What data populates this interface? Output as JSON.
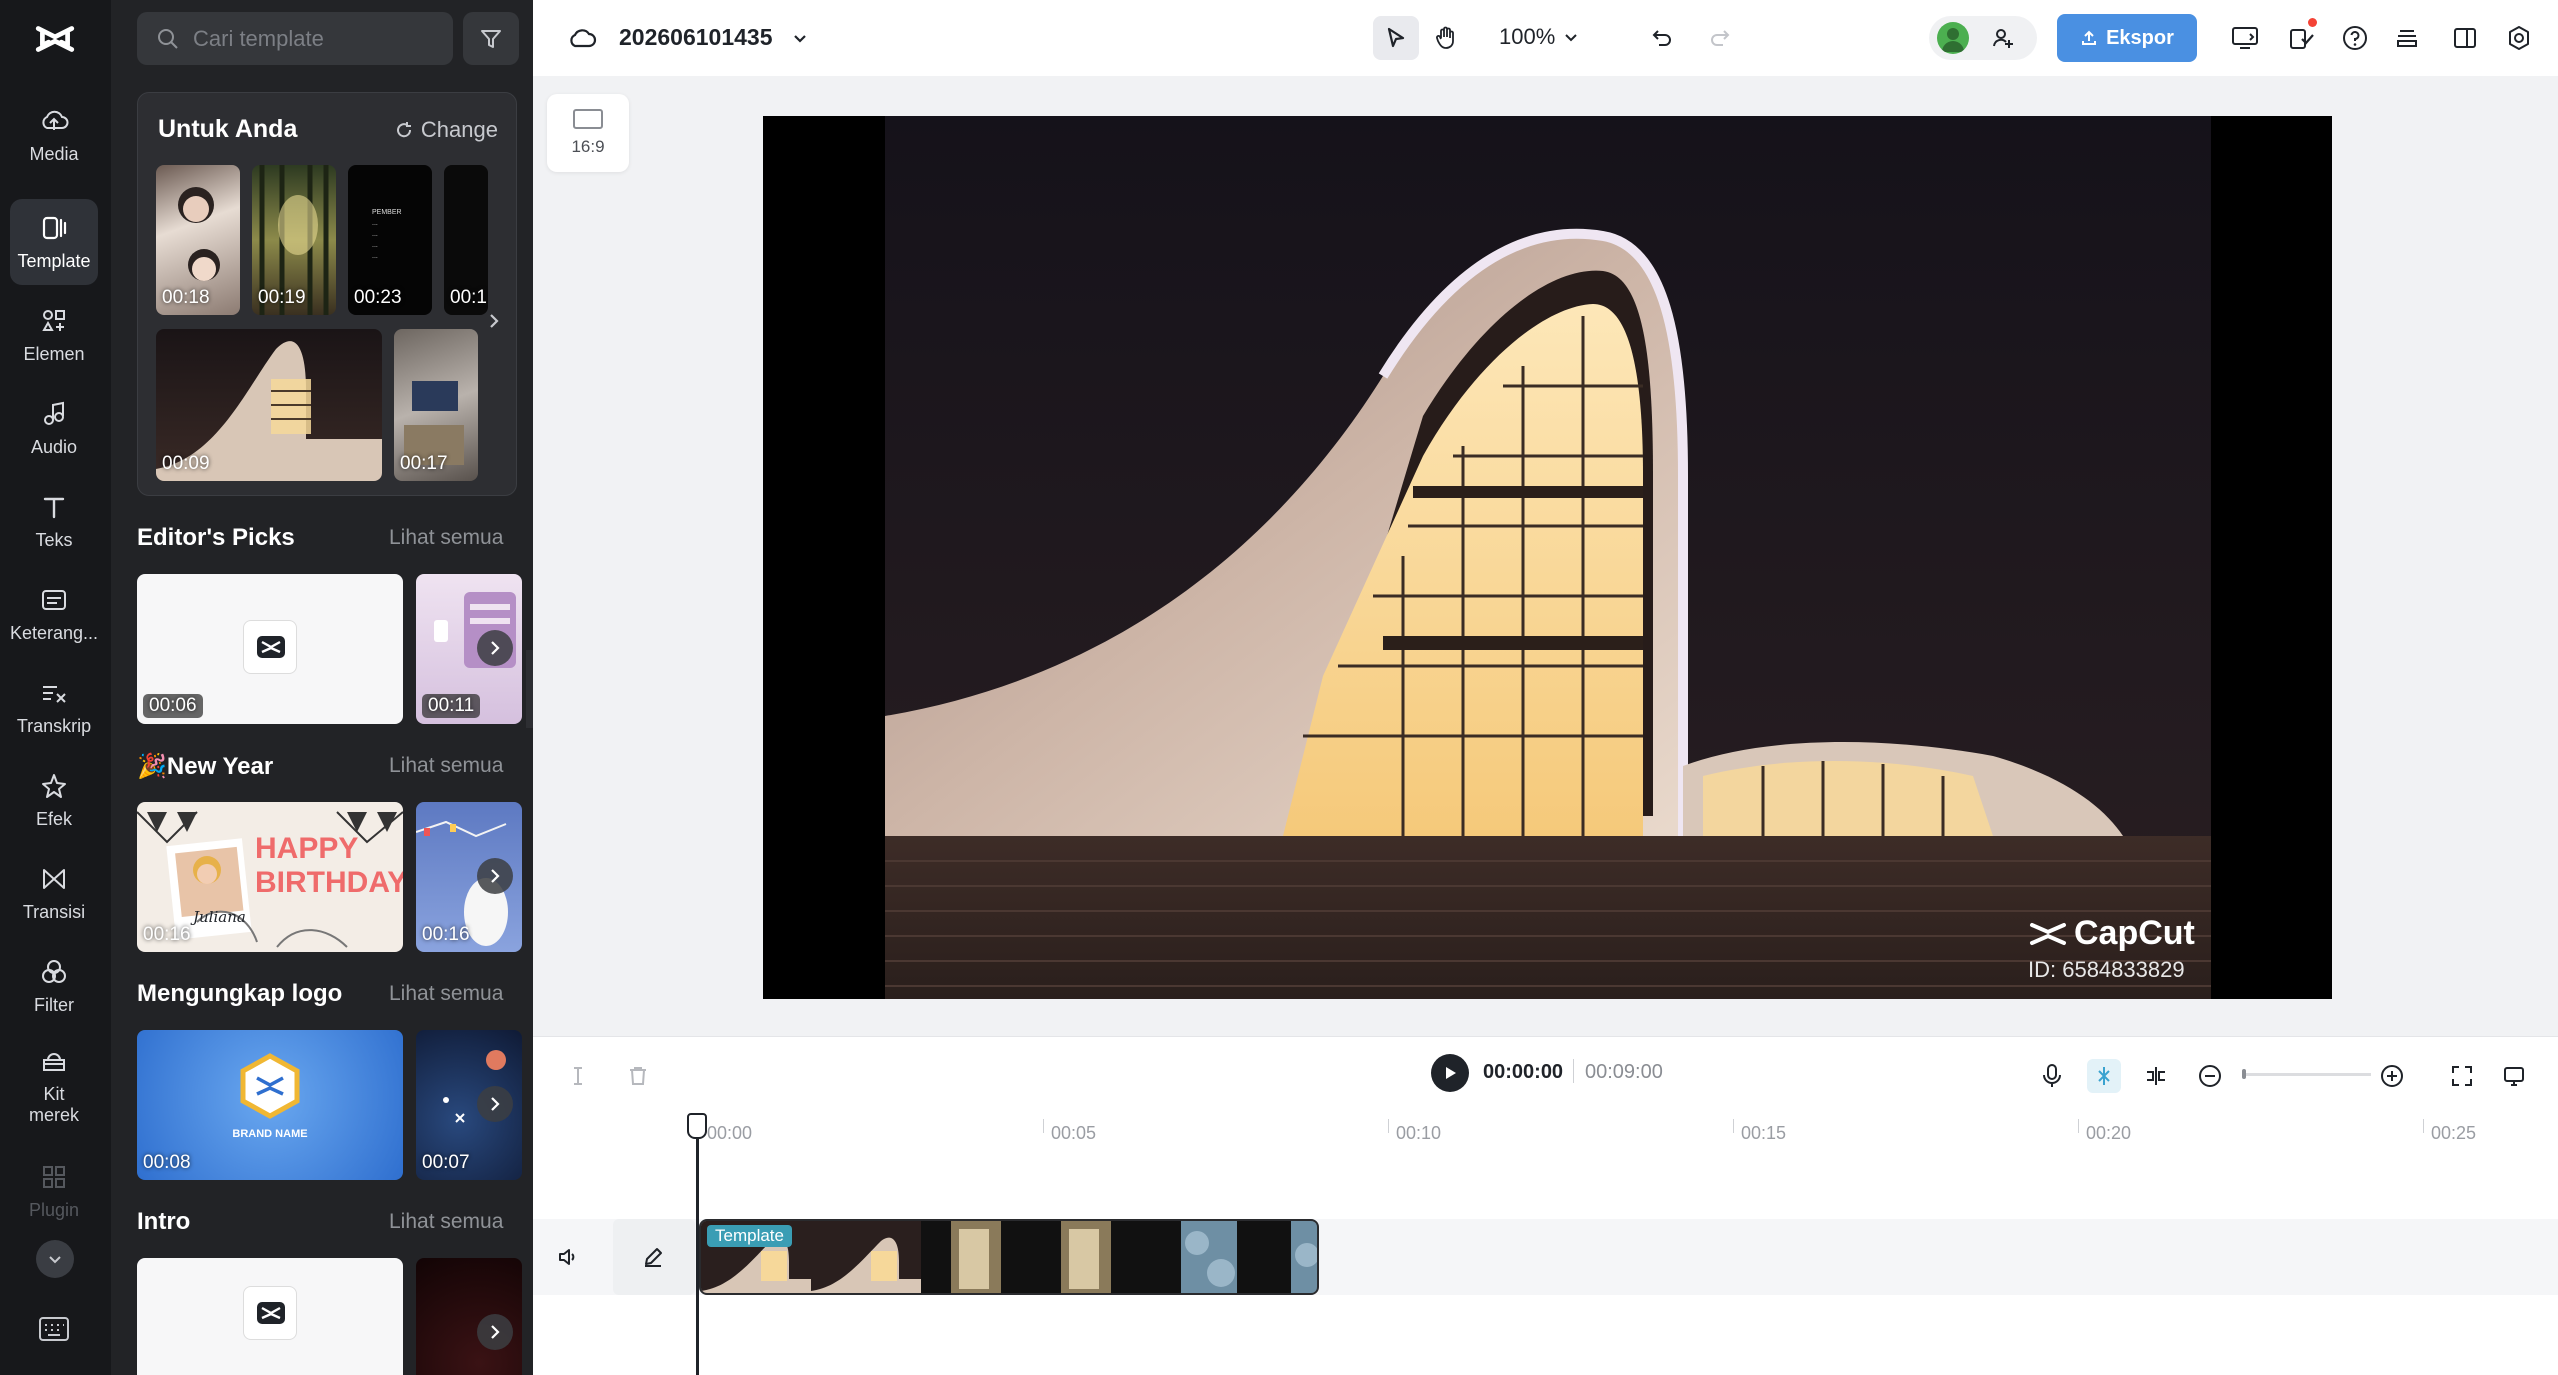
{
  "rail": {
    "items": [
      {
        "label": "Media",
        "icon": "cloud-upload-icon"
      },
      {
        "label": "Template",
        "icon": "template-icon",
        "active": true
      },
      {
        "label": "Elemen",
        "icon": "elements-icon"
      },
      {
        "label": "Audio",
        "icon": "music-note-icon"
      },
      {
        "label": "Teks",
        "icon": "text-icon"
      },
      {
        "label": "Keterang...",
        "icon": "captions-icon"
      },
      {
        "label": "Transkrip",
        "icon": "transcript-icon"
      },
      {
        "label": "Efek",
        "icon": "effects-icon"
      },
      {
        "label": "Transisi",
        "icon": "transition-icon"
      },
      {
        "label": "Filter",
        "icon": "filter-icon"
      },
      {
        "label": "Kit merek",
        "icon": "brand-kit-icon"
      },
      {
        "label": "Plugin",
        "icon": "plugin-icon"
      }
    ]
  },
  "panel": {
    "search_placeholder": "Cari template",
    "for_you": {
      "title": "Untuk Anda",
      "change_label": "Change",
      "thumbs": [
        "00:18",
        "00:19",
        "00:23",
        "00:1",
        "00:09",
        "00:17"
      ],
      "phone_lines": [
        "PEMBER",
        "...",
        "...",
        "...",
        "..."
      ]
    },
    "sections": [
      {
        "title": "Editor's Picks",
        "link": "Lihat semua",
        "durations": [
          "00:06",
          "00:11"
        ]
      },
      {
        "title": "🎉New Year",
        "link": "Lihat semua",
        "durations": [
          "00:16",
          "00:16"
        ],
        "card_text": "HAPPY BIRTHDAY",
        "signature": "Juliana"
      },
      {
        "title": "Mengungkap logo",
        "link": "Lihat semua",
        "durations": [
          "00:08",
          "00:07"
        ],
        "brand_name": "BRAND NAME"
      },
      {
        "title": "Intro",
        "link": "Lihat semua",
        "durations": []
      }
    ]
  },
  "topbar": {
    "project_name": "202606101435",
    "zoom": "100%",
    "export_label": "Ekspor"
  },
  "canvas": {
    "ratio_label": "16:9",
    "watermark_brand": "CapCut",
    "watermark_id": "ID: 6584833829"
  },
  "timeline": {
    "current_time": "00:00:00",
    "total_time": "00:09:00",
    "ruler": [
      "00:00",
      "00:05",
      "00:10",
      "00:15",
      "00:20",
      "00:25"
    ],
    "clip_label": "Template"
  },
  "colors": {
    "accent": "#4a90e2",
    "rail_bg": "#17181b",
    "panel_bg": "#222326",
    "clip_tag": "#3a9db4"
  }
}
